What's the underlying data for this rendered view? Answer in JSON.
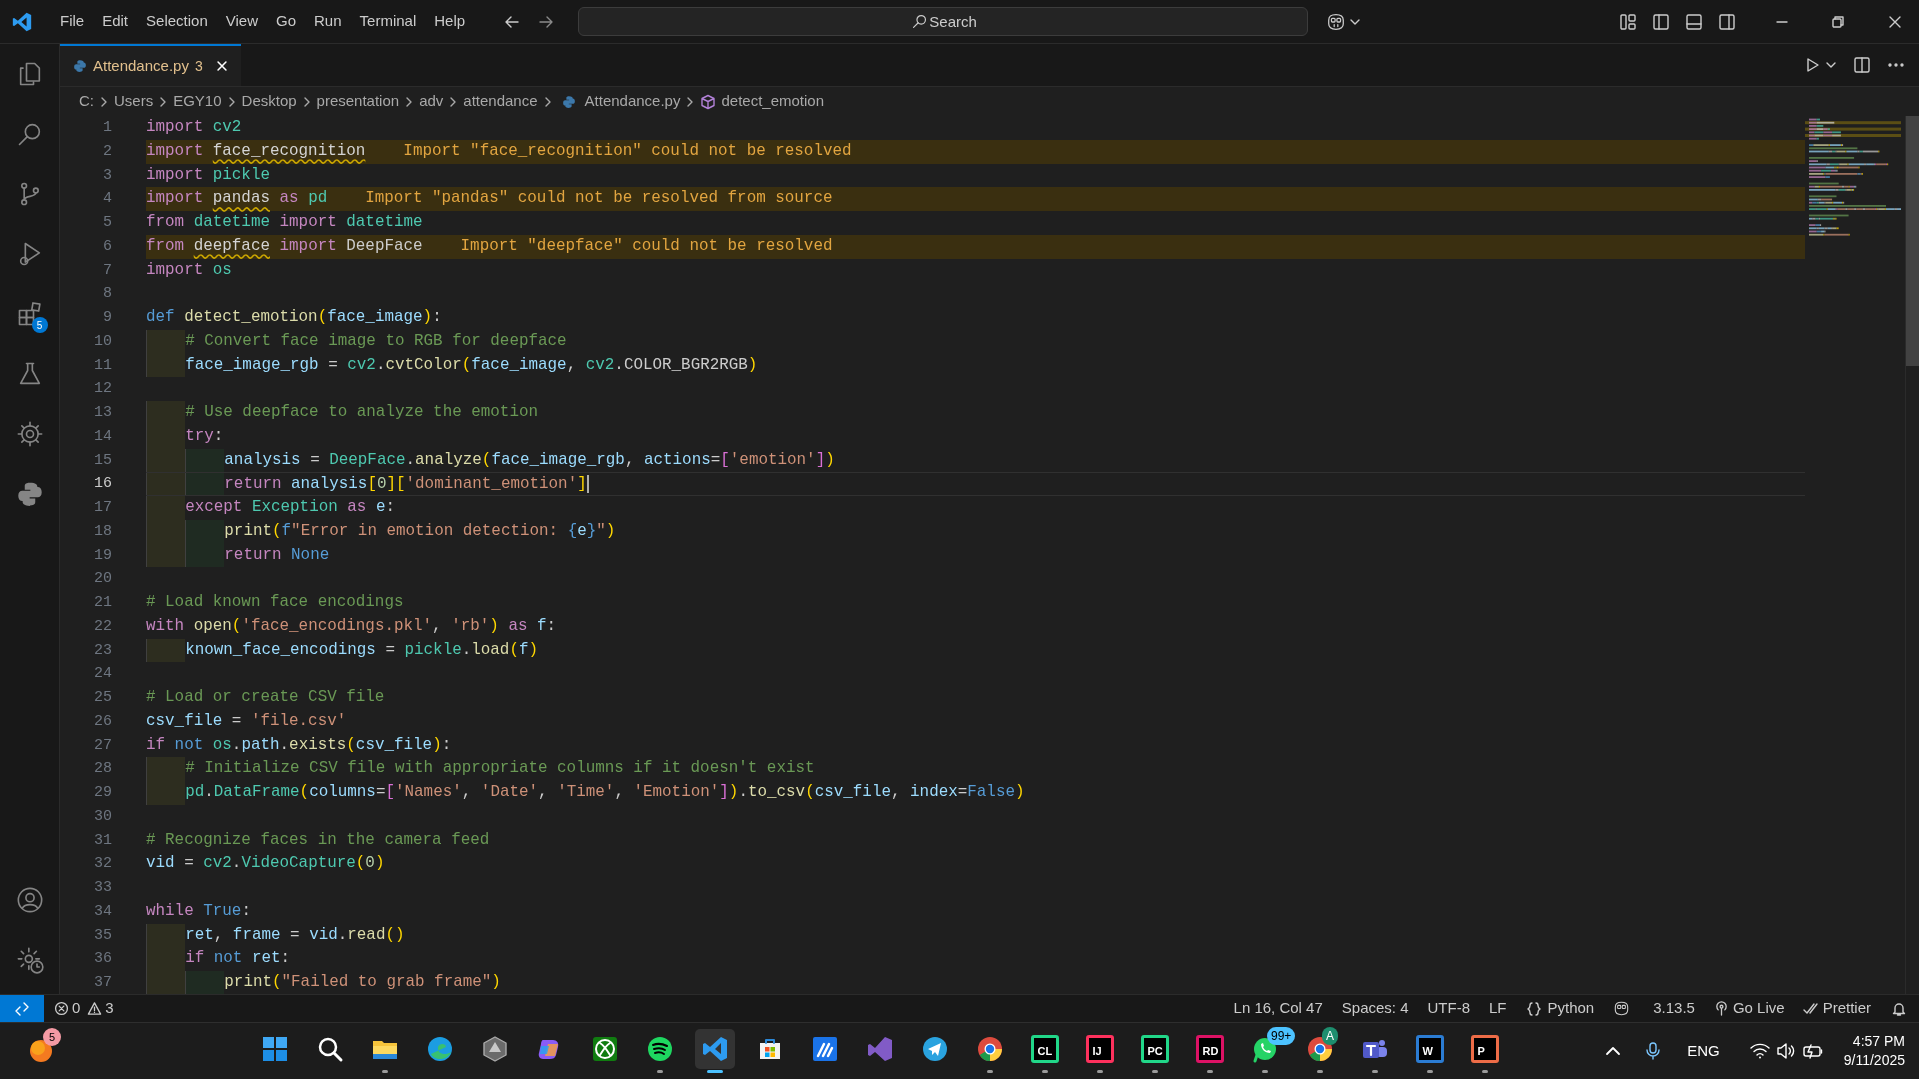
{
  "menu": [
    "File",
    "Edit",
    "Selection",
    "View",
    "Go",
    "Run",
    "Terminal",
    "Help"
  ],
  "search": {
    "placeholder": "Search"
  },
  "tab": {
    "title": "Attendance.py",
    "problems": "3",
    "selected": true
  },
  "breadcrumbs": [
    {
      "kind": "folder",
      "text": "C:"
    },
    {
      "kind": "folder",
      "text": "Users"
    },
    {
      "kind": "folder",
      "text": "EGY10"
    },
    {
      "kind": "folder",
      "text": "Desktop"
    },
    {
      "kind": "folder",
      "text": "presentation"
    },
    {
      "kind": "folder",
      "text": "adv"
    },
    {
      "kind": "folder",
      "text": "attendance"
    },
    {
      "kind": "file",
      "text": "Attendance.py"
    },
    {
      "kind": "symbol",
      "text": "detect_emotion"
    }
  ],
  "activity_bar": [
    {
      "kind": "explorer"
    },
    {
      "kind": "search"
    },
    {
      "kind": "source-control"
    },
    {
      "kind": "run-debug"
    },
    {
      "kind": "extensions",
      "badge": "5"
    },
    {
      "kind": "testing"
    },
    {
      "kind": "remote"
    },
    {
      "kind": "python"
    },
    {
      "kind": "account"
    },
    {
      "kind": "manage"
    }
  ],
  "editor": {
    "lines": [
      {
        "number": "1",
        "current": false,
        "tokens": [
          {
            "kind": "kw",
            "text": "import "
          },
          {
            "kind": "mod",
            "text": "cv2"
          }
        ]
      },
      {
        "number": "2",
        "current": false,
        "tokens": [
          {
            "kind": "kw",
            "text": "import "
          },
          {
            "kind": "bad",
            "text": "face_recognition"
          }
        ],
        "warning": "Import \"face_recognition\" could not be resolved"
      },
      {
        "number": "3",
        "current": false,
        "tokens": [
          {
            "kind": "kw",
            "text": "import "
          },
          {
            "kind": "mod",
            "text": "pickle"
          }
        ]
      },
      {
        "number": "4",
        "current": false,
        "tokens": [
          {
            "kind": "kw",
            "text": "import "
          },
          {
            "kind": "bad",
            "text": "pandas"
          },
          {
            "kind": "kw",
            "text": " as "
          },
          {
            "kind": "mod",
            "text": "pd"
          }
        ],
        "warning": "Import \"pandas\" could not be resolved from source"
      },
      {
        "number": "5",
        "current": false,
        "tokens": [
          {
            "kind": "kw",
            "text": "from "
          },
          {
            "kind": "mod",
            "text": "datetime"
          },
          {
            "kind": "kw",
            "text": " import "
          },
          {
            "kind": "cls",
            "text": "datetime"
          }
        ]
      },
      {
        "number": "6",
        "current": false,
        "tokens": [
          {
            "kind": "kw",
            "text": "from "
          },
          {
            "kind": "bad",
            "text": "deepface"
          },
          {
            "kind": "kw",
            "text": " import "
          },
          {
            "kind": "pl",
            "text": "DeepFace"
          }
        ],
        "warning": "Import \"deepface\" could not be resolved"
      },
      {
        "number": "7",
        "current": false,
        "tokens": [
          {
            "kind": "kw",
            "text": "import "
          },
          {
            "kind": "mod",
            "text": "os"
          }
        ]
      },
      {
        "number": "8",
        "current": false
      },
      {
        "number": "9",
        "current": false,
        "tokens": [
          {
            "kind": "key",
            "text": "def "
          },
          {
            "kind": "fn",
            "text": "detect_emotion"
          },
          {
            "kind": "b1",
            "text": "("
          },
          {
            "kind": "var",
            "text": "face_image"
          },
          {
            "kind": "b1",
            "text": ")"
          },
          {
            "kind": "pl",
            "text": ":"
          }
        ]
      },
      {
        "number": "10",
        "current": false,
        "tokens": [
          {
            "kind": "com",
            "text": "    # Convert face image to RGB for deepface"
          }
        ]
      },
      {
        "number": "11",
        "current": false,
        "tokens": [
          {
            "kind": "var",
            "text": "    face_image_rgb"
          },
          {
            "kind": "pl",
            "text": " = "
          },
          {
            "kind": "mod",
            "text": "cv2"
          },
          {
            "kind": "pl",
            "text": "."
          },
          {
            "kind": "fn",
            "text": "cvtColor"
          },
          {
            "kind": "b1",
            "text": "("
          },
          {
            "kind": "var",
            "text": "face_image"
          },
          {
            "kind": "pl",
            "text": ", "
          },
          {
            "kind": "mod",
            "text": "cv2"
          },
          {
            "kind": "pl",
            "text": "."
          },
          {
            "kind": "const",
            "text": "COLOR_BGR2RGB"
          },
          {
            "kind": "b1",
            "text": ")"
          }
        ]
      },
      {
        "number": "12",
        "current": false
      },
      {
        "number": "13",
        "current": false,
        "tokens": [
          {
            "kind": "com",
            "text": "    # Use deepface to analyze the emotion"
          }
        ]
      },
      {
        "number": "14",
        "current": false,
        "tokens": [
          {
            "kind": "kw",
            "text": "    try"
          },
          {
            "kind": "pl",
            "text": ":"
          }
        ]
      },
      {
        "number": "15",
        "current": false,
        "tokens": [
          {
            "kind": "var",
            "text": "        analysis"
          },
          {
            "kind": "pl",
            "text": " = "
          },
          {
            "kind": "cls",
            "text": "DeepFace"
          },
          {
            "kind": "pl",
            "text": "."
          },
          {
            "kind": "fn",
            "text": "analyze"
          },
          {
            "kind": "b1",
            "text": "("
          },
          {
            "kind": "var",
            "text": "face_image_rgb"
          },
          {
            "kind": "pl",
            "text": ", "
          },
          {
            "kind": "var",
            "text": "actions"
          },
          {
            "kind": "pl",
            "text": "="
          },
          {
            "kind": "b2",
            "text": "["
          },
          {
            "kind": "str",
            "text": "'emotion'"
          },
          {
            "kind": "b2",
            "text": "]"
          },
          {
            "kind": "b1",
            "text": ")"
          }
        ]
      },
      {
        "number": "16",
        "current": true,
        "tokens": [
          {
            "kind": "kw",
            "text": "        return "
          },
          {
            "kind": "var",
            "text": "analysis"
          },
          {
            "kind": "b1",
            "text": "["
          },
          {
            "kind": "num",
            "text": "0"
          },
          {
            "kind": "b1",
            "text": "]["
          },
          {
            "kind": "str",
            "text": "'dominant_emotion'"
          },
          {
            "kind": "b1",
            "text": "]"
          }
        ]
      },
      {
        "number": "17",
        "current": false,
        "tokens": [
          {
            "kind": "kw",
            "text": "    except "
          },
          {
            "kind": "cls",
            "text": "Exception"
          },
          {
            "kind": "kw",
            "text": " as "
          },
          {
            "kind": "var",
            "text": "e"
          },
          {
            "kind": "pl",
            "text": ":"
          }
        ]
      },
      {
        "number": "18",
        "current": false,
        "tokens": [
          {
            "kind": "fn",
            "text": "        print"
          },
          {
            "kind": "b1",
            "text": "("
          },
          {
            "kind": "key",
            "text": "f"
          },
          {
            "kind": "str",
            "text": "\"Error in emotion detection: "
          },
          {
            "kind": "key",
            "text": "{"
          },
          {
            "kind": "var",
            "text": "e"
          },
          {
            "kind": "key",
            "text": "}"
          },
          {
            "kind": "str",
            "text": "\""
          },
          {
            "kind": "b1",
            "text": ")"
          }
        ]
      },
      {
        "number": "19",
        "current": false,
        "tokens": [
          {
            "kind": "kw",
            "text": "        return "
          },
          {
            "kind": "key",
            "text": "None"
          }
        ]
      },
      {
        "number": "20",
        "current": false
      },
      {
        "number": "21",
        "current": false,
        "tokens": [
          {
            "kind": "com",
            "text": "# Load known face encodings"
          }
        ]
      },
      {
        "number": "22",
        "current": false,
        "tokens": [
          {
            "kind": "kw",
            "text": "with "
          },
          {
            "kind": "fn",
            "text": "open"
          },
          {
            "kind": "b1",
            "text": "("
          },
          {
            "kind": "str",
            "text": "'face_encodings.pkl'"
          },
          {
            "kind": "pl",
            "text": ", "
          },
          {
            "kind": "str",
            "text": "'rb'"
          },
          {
            "kind": "b1",
            "text": ")"
          },
          {
            "kind": "kw",
            "text": " as "
          },
          {
            "kind": "var",
            "text": "f"
          },
          {
            "kind": "pl",
            "text": ":"
          }
        ]
      },
      {
        "number": "23",
        "current": false,
        "tokens": [
          {
            "kind": "var",
            "text": "    known_face_encodings"
          },
          {
            "kind": "pl",
            "text": " = "
          },
          {
            "kind": "mod",
            "text": "pickle"
          },
          {
            "kind": "pl",
            "text": "."
          },
          {
            "kind": "fn",
            "text": "load"
          },
          {
            "kind": "b1",
            "text": "("
          },
          {
            "kind": "var",
            "text": "f"
          },
          {
            "kind": "b1",
            "text": ")"
          }
        ]
      },
      {
        "number": "24",
        "current": false
      },
      {
        "number": "25",
        "current": false,
        "tokens": [
          {
            "kind": "com",
            "text": "# Load or create CSV file"
          }
        ]
      },
      {
        "number": "26",
        "current": false,
        "tokens": [
          {
            "kind": "var",
            "text": "csv_file"
          },
          {
            "kind": "pl",
            "text": " = "
          },
          {
            "kind": "str",
            "text": "'file.csv'"
          }
        ]
      },
      {
        "number": "27",
        "current": false,
        "tokens": [
          {
            "kind": "kw",
            "text": "if "
          },
          {
            "kind": "key",
            "text": "not "
          },
          {
            "kind": "mod",
            "text": "os"
          },
          {
            "kind": "pl",
            "text": "."
          },
          {
            "kind": "var",
            "text": "path"
          },
          {
            "kind": "pl",
            "text": "."
          },
          {
            "kind": "fn",
            "text": "exists"
          },
          {
            "kind": "b1",
            "text": "("
          },
          {
            "kind": "var",
            "text": "csv_file"
          },
          {
            "kind": "b1",
            "text": ")"
          },
          {
            "kind": "pl",
            "text": ":"
          }
        ]
      },
      {
        "number": "28",
        "current": false,
        "tokens": [
          {
            "kind": "com",
            "text": "    # Initialize CSV file with appropriate columns if it doesn't exist"
          }
        ]
      },
      {
        "number": "29",
        "current": false,
        "tokens": [
          {
            "kind": "mod",
            "text": "    pd"
          },
          {
            "kind": "pl",
            "text": "."
          },
          {
            "kind": "cls",
            "text": "DataFrame"
          },
          {
            "kind": "b1",
            "text": "("
          },
          {
            "kind": "var",
            "text": "columns"
          },
          {
            "kind": "pl",
            "text": "="
          },
          {
            "kind": "b2",
            "text": "["
          },
          {
            "kind": "str",
            "text": "'Names'"
          },
          {
            "kind": "pl",
            "text": ", "
          },
          {
            "kind": "str",
            "text": "'Date'"
          },
          {
            "kind": "pl",
            "text": ", "
          },
          {
            "kind": "str",
            "text": "'Time'"
          },
          {
            "kind": "pl",
            "text": ", "
          },
          {
            "kind": "str",
            "text": "'Emotion'"
          },
          {
            "kind": "b2",
            "text": "]"
          },
          {
            "kind": "b1",
            "text": ")"
          },
          {
            "kind": "pl",
            "text": "."
          },
          {
            "kind": "fn",
            "text": "to_csv"
          },
          {
            "kind": "b1",
            "text": "("
          },
          {
            "kind": "var",
            "text": "csv_file"
          },
          {
            "kind": "pl",
            "text": ", "
          },
          {
            "kind": "var",
            "text": "index"
          },
          {
            "kind": "pl",
            "text": "="
          },
          {
            "kind": "key",
            "text": "False"
          },
          {
            "kind": "b1",
            "text": ")"
          }
        ]
      },
      {
        "number": "30",
        "current": false
      },
      {
        "number": "31",
        "current": false,
        "tokens": [
          {
            "kind": "com",
            "text": "# Recognize faces in the camera feed"
          }
        ]
      },
      {
        "number": "32",
        "current": false,
        "tokens": [
          {
            "kind": "var",
            "text": "vid"
          },
          {
            "kind": "pl",
            "text": " = "
          },
          {
            "kind": "mod",
            "text": "cv2"
          },
          {
            "kind": "pl",
            "text": "."
          },
          {
            "kind": "cls",
            "text": "VideoCapture"
          },
          {
            "kind": "b1",
            "text": "("
          },
          {
            "kind": "num",
            "text": "0"
          },
          {
            "kind": "b1",
            "text": ")"
          }
        ]
      },
      {
        "number": "33",
        "current": false
      },
      {
        "number": "34",
        "current": false,
        "tokens": [
          {
            "kind": "kw",
            "text": "while "
          },
          {
            "kind": "key",
            "text": "True"
          },
          {
            "kind": "pl",
            "text": ":"
          }
        ]
      },
      {
        "number": "35",
        "current": false,
        "tokens": [
          {
            "kind": "var",
            "text": "    ret"
          },
          {
            "kind": "pl",
            "text": ", "
          },
          {
            "kind": "var",
            "text": "frame"
          },
          {
            "kind": "pl",
            "text": " = "
          },
          {
            "kind": "var",
            "text": "vid"
          },
          {
            "kind": "pl",
            "text": "."
          },
          {
            "kind": "fn",
            "text": "read"
          },
          {
            "kind": "b1",
            "text": "()"
          }
        ]
      },
      {
        "number": "36",
        "current": false,
        "tokens": [
          {
            "kind": "kw",
            "text": "    if "
          },
          {
            "kind": "key",
            "text": "not "
          },
          {
            "kind": "var",
            "text": "ret"
          },
          {
            "kind": "pl",
            "text": ":"
          }
        ]
      },
      {
        "number": "37",
        "current": false,
        "tokens": [
          {
            "kind": "fn",
            "text": "        print"
          },
          {
            "kind": "b1",
            "text": "("
          },
          {
            "kind": "str",
            "text": "\"Failed to grab frame\""
          },
          {
            "kind": "b1",
            "text": ")"
          }
        ]
      }
    ]
  },
  "status_bar": {
    "errors": "0",
    "warnings": "3",
    "items": [
      {
        "kind": "text",
        "text": "Ln 16, Col 47"
      },
      {
        "kind": "text",
        "text": "Spaces: 4"
      },
      {
        "kind": "text",
        "text": "UTF-8"
      },
      {
        "kind": "text",
        "text": "LF"
      },
      {
        "kind": "language",
        "text": "Python"
      },
      {
        "kind": "copilot"
      },
      {
        "kind": "text",
        "text": "3.13.5"
      },
      {
        "kind": "golive",
        "text": "Go Live"
      },
      {
        "kind": "prettier",
        "text": "Prettier"
      },
      {
        "kind": "bell"
      }
    ]
  },
  "taskbar": {
    "widget_badge": "5",
    "apps": [
      {
        "kind": "start",
        "running": false,
        "selected": false
      },
      {
        "kind": "search",
        "running": false,
        "selected": false
      },
      {
        "kind": "folder",
        "running": true,
        "selected": false
      },
      {
        "kind": "edge",
        "running": false,
        "selected": false
      },
      {
        "kind": "hexagon",
        "running": false,
        "selected": false
      },
      {
        "kind": "copilot",
        "running": false,
        "selected": false
      },
      {
        "kind": "xbox",
        "running": false,
        "selected": false
      },
      {
        "kind": "spotify",
        "running": true,
        "selected": false
      },
      {
        "kind": "vscode",
        "running": true,
        "selected": true
      },
      {
        "kind": "store",
        "running": false,
        "selected": false
      },
      {
        "kind": "pen",
        "running": false,
        "selected": false
      },
      {
        "kind": "vs",
        "running": false,
        "selected": false
      },
      {
        "kind": "telegram",
        "running": false,
        "selected": false
      },
      {
        "kind": "chrome",
        "running": true,
        "selected": false
      },
      {
        "kind": "tile",
        "label": "CL",
        "color": "#21d789",
        "running": true,
        "selected": false
      },
      {
        "kind": "tile",
        "label": "IJ",
        "color": "#fe315d",
        "running": true,
        "selected": false
      },
      {
        "kind": "tile",
        "label": "PC",
        "color": "#21d789",
        "running": true,
        "selected": false
      },
      {
        "kind": "tile",
        "label": "RD",
        "color": "#dd1265",
        "running": true,
        "selected": false
      },
      {
        "kind": "whatsapp",
        "badge": "99+",
        "running": true,
        "selected": false
      },
      {
        "kind": "chrome",
        "badge": "A",
        "running": true,
        "selected": false
      },
      {
        "kind": "teams",
        "running": true,
        "selected": false
      },
      {
        "kind": "tile",
        "label": "W",
        "color": "#2b7cd3",
        "running": true,
        "selected": false
      },
      {
        "kind": "tile",
        "label": "P",
        "color": "#ed6c47",
        "running": true,
        "selected": false
      }
    ],
    "language": "ENG",
    "time": "4:57 PM",
    "date": "9/11/2025"
  }
}
